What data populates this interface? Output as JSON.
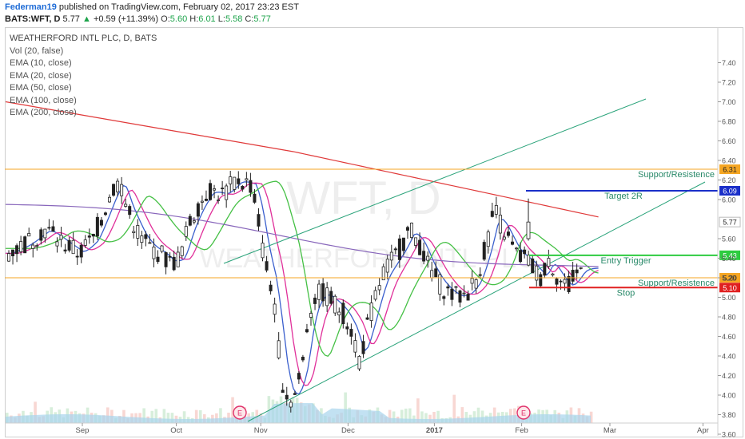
{
  "header": {
    "author": "Federman19",
    "published": "published on TradingView.com, February 02, 2017 23:23 EST",
    "symbol": "BATS:WFT, D",
    "last": "5.77",
    "change": "+0.59 (+11.39%)",
    "open_label": "O:",
    "open": "5.60",
    "high_label": "H:",
    "high": "6.01",
    "low_label": "L:",
    "low": "5.58",
    "close_label": "C:",
    "close": "5.77"
  },
  "legend": {
    "title": "WEATHERFORD INTL PLC, D, BATS",
    "items": [
      "Vol (20, false)",
      "EMA (10, close)",
      "EMA (20, close)",
      "EMA (50, close)",
      "EMA (100, close)",
      "EMA (200, close)"
    ]
  },
  "watermark": {
    "symbol": "WFT, D",
    "name": "WEATHERFORD INTL PLC"
  },
  "chart_data": {
    "type": "candlestick",
    "y_ticks": [
      "3.60",
      "3.80",
      "4.00",
      "4.20",
      "4.40",
      "4.60",
      "4.80",
      "5.00",
      "5.20",
      "5.40",
      "5.60",
      "5.77",
      "6.00",
      "6.20",
      "6.40",
      "6.60",
      "6.80",
      "7.00",
      "7.20",
      "7.40"
    ],
    "x_ticks": [
      "Sep",
      "Oct",
      "Nov",
      "Dec",
      "2017",
      "Feb",
      "Mar",
      "Apr"
    ],
    "ylim": [
      3.55,
      7.5
    ],
    "horizontal_levels": [
      {
        "label": "Support/Resistence",
        "price": 6.31,
        "tag": "6.31",
        "color": "#f5a623"
      },
      {
        "label": "Target 2R",
        "price": 6.09,
        "tag": "6.09",
        "color": "#1a2fc9"
      },
      {
        "label": "Entry Trigger",
        "price": 5.43,
        "tag": "5.43",
        "color": "#2ecc40"
      },
      {
        "label": "Support/Resistence",
        "price": 5.2,
        "tag": "5.20",
        "color": "#f5a623"
      },
      {
        "label": "Stop",
        "price": 5.1,
        "tag": "5.10",
        "color": "#e02020"
      }
    ],
    "last_price_tag": "5.77",
    "earnings_markers": [
      "E",
      "E"
    ],
    "colors": {
      "up": "#ffffff",
      "down": "#222222",
      "ema10": "#3a5fcd",
      "ema20": "#e0309a",
      "ema50": "#45c045",
      "ema100": "#8866bb",
      "ema200": "#e03a3a",
      "channel": "#2aa37a",
      "volume": "#a8d4ec"
    }
  }
}
